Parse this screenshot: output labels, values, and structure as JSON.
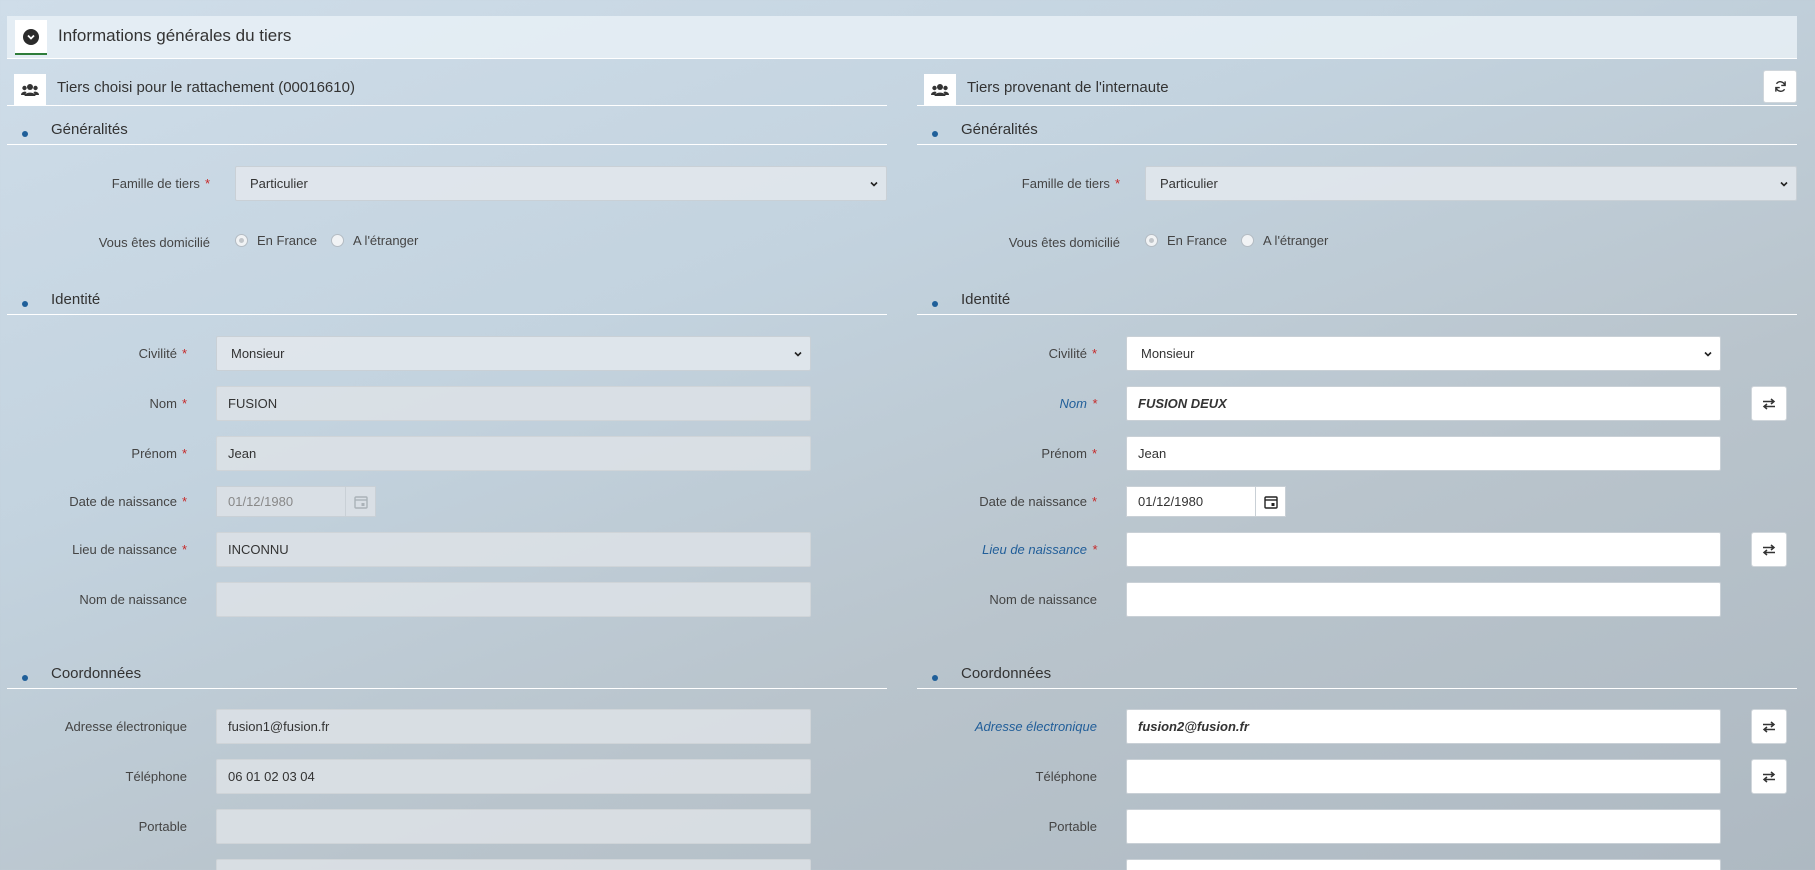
{
  "main_header": {
    "title": "Informations générales du tiers"
  },
  "left": {
    "header_title": "Tiers choisi pour le rattachement (00016610)",
    "sections": {
      "generalites": "Généralités",
      "identite": "Identité",
      "coordonnees": "Coordonnées"
    },
    "fields": {
      "famille_label": "Famille de tiers",
      "famille_value": "Particulier",
      "domicile_label": "Vous êtes domicilié",
      "radio_france": "En France",
      "radio_etranger": "A l'étranger",
      "civilite_label": "Civilité",
      "civilite_value": "Monsieur",
      "nom_label": "Nom",
      "nom_value": "FUSION",
      "prenom_label": "Prénom",
      "prenom_value": "Jean",
      "date_label": "Date de naissance",
      "date_value": "01/12/1980",
      "lieu_label": "Lieu de naissance",
      "lieu_value": "INCONNU",
      "nom_naissance_label": "Nom de naissance",
      "nom_naissance_value": "",
      "email_label": "Adresse électronique",
      "email_value": "fusion1@fusion.fr",
      "tel_label": "Téléphone",
      "tel_value": "06 01 02 03 04",
      "portable_label": "Portable",
      "portable_value": ""
    }
  },
  "right": {
    "header_title": "Tiers provenant de l'internaute",
    "sections": {
      "generalites": "Généralités",
      "identite": "Identité",
      "coordonnees": "Coordonnées"
    },
    "fields": {
      "famille_label": "Famille de tiers",
      "famille_value": "Particulier",
      "domicile_label": "Vous êtes domicilié",
      "radio_france": "En France",
      "radio_etranger": "A l'étranger",
      "civilite_label": "Civilité",
      "civilite_value": "Monsieur",
      "nom_label": "Nom",
      "nom_value": "FUSION DEUX",
      "prenom_label": "Prénom",
      "prenom_value": "Jean",
      "date_label": "Date de naissance",
      "date_value": "01/12/1980",
      "lieu_label": "Lieu de naissance",
      "lieu_value": "",
      "nom_naissance_label": "Nom de naissance",
      "nom_naissance_value": "",
      "email_label": "Adresse électronique",
      "email_value": "fusion2@fusion.fr",
      "tel_label": "Téléphone",
      "tel_value": "",
      "portable_label": "Portable",
      "portable_value": ""
    }
  },
  "required_marker": "*",
  "icons": {
    "toggle": "chevron-down-circle-icon",
    "users": "users-icon",
    "refresh": "refresh-icon",
    "calendar": "calendar-icon",
    "swap": "swap-arrows-icon"
  },
  "colors": {
    "required": "#c62828",
    "diff_label": "#215e99",
    "section_dot": "#1f5f99"
  }
}
